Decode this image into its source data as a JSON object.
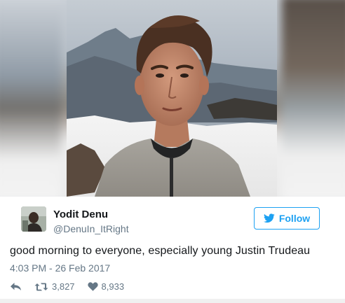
{
  "user": {
    "name": "Yodit Denu",
    "handle": "@DenuIn_ItRight"
  },
  "follow_button": {
    "label": "Follow"
  },
  "tweet": {
    "text": "good morning to everyone, especially young Justin Trudeau",
    "timestamp": "4:03 PM - 26 Feb 2017"
  },
  "actions": {
    "reply_icon": "reply-arrow-icon",
    "retweet_count": "3,827",
    "like_count": "8,933"
  },
  "colors": {
    "brand_blue": "#1da1f2",
    "secondary_text": "#657786",
    "primary_text": "#14171a"
  }
}
